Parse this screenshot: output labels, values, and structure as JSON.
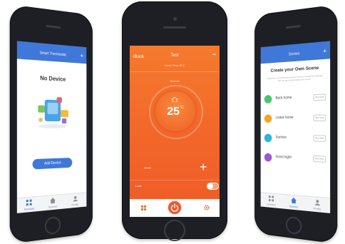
{
  "left_app": {
    "title": "Smart Thermostat",
    "plus": "+",
    "empty_title": "No Device",
    "add_button": "Add Device",
    "tabs": [
      "Devices",
      "Scenes",
      "Profile"
    ],
    "accent": "#3f78d8"
  },
  "center_app": {
    "back": "Back",
    "title": "Test",
    "menu": "•••",
    "info": "Indoor Temp 25°C",
    "mode": "Normal",
    "temperature": "25",
    "unit": "°C",
    "minus": "—",
    "plus": "+",
    "lock_label": "Lock",
    "accent": "#f26b2a"
  },
  "right_app": {
    "title": "Scenes",
    "plus": "+",
    "heading": "Create your Own Scene",
    "subtitle": "Customize your personal scenes to suit your needs for example, set one tap to personalize your home",
    "scenes": [
      {
        "label": "Back home",
        "color": "#4cc46a",
        "button": "Run Now"
      },
      {
        "label": "Leave home",
        "color": "#f5a623",
        "button": "Run Now"
      },
      {
        "label": "Sunrise",
        "color": "#29b6d9",
        "button": "Run Now"
      },
      {
        "label": "Good night",
        "color": "#9b59d0",
        "button": "Run Now"
      }
    ],
    "tabs": [
      "Devices",
      "Scenes",
      "Profile"
    ],
    "accent": "#3f78d8"
  }
}
